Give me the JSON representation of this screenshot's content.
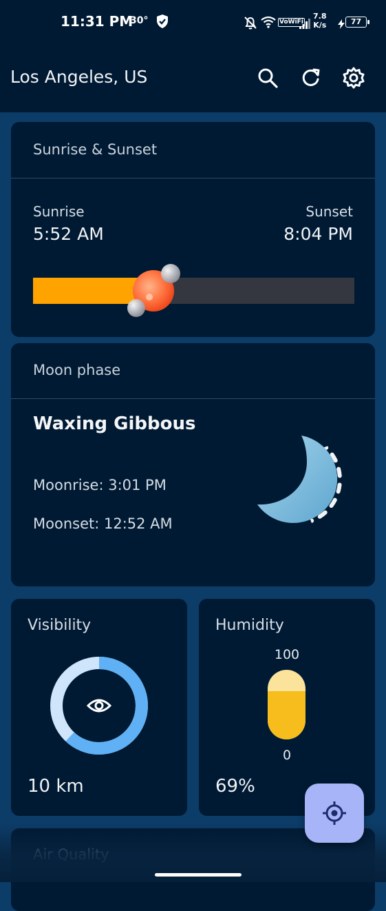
{
  "status_bar": {
    "time": "11:31 PM",
    "temperature": "30°",
    "network_speed_value": "7.8",
    "network_speed_unit": "K/s",
    "wifi_label": "VoWiFi",
    "battery_level": "77"
  },
  "header": {
    "location": "Los Angeles, US",
    "icons": [
      "search-icon",
      "refresh-icon",
      "settings-icon"
    ]
  },
  "sunrise_card": {
    "title": "Sunrise & Sunset",
    "sunrise_label": "Sunrise",
    "sunrise_time": "5:52 AM",
    "sunset_label": "Sunset",
    "sunset_time": "8:04 PM",
    "day_progress": 0.38,
    "colors": {
      "fill": "#ffa300",
      "track": "#343740",
      "sun": "#ff6a3a"
    }
  },
  "moon_card": {
    "title": "Moon phase",
    "phase": "Waxing Gibbous",
    "moonrise": "Moonrise: 3:01 PM",
    "moonset": "Moonset: 12:52 AM",
    "colors": {
      "moon": "#7fbddc"
    }
  },
  "visibility_card": {
    "title": "Visibility",
    "value": "10 km",
    "ring_fraction": 0.62,
    "icon": "eye-icon",
    "colors": {
      "ring": "#5fb0f4",
      "ring_track": "#cfe5fb"
    }
  },
  "humidity_card": {
    "title": "Humidity",
    "scale_max": "100",
    "scale_min": "0",
    "value": "69%",
    "fill_fraction": 0.69,
    "colors": {
      "fill": "#f7bd1c",
      "empty": "#fbe39b"
    }
  },
  "air_quality_card": {
    "title": "Air Quality"
  },
  "fab": {
    "icon": "my-location-icon",
    "colors": {
      "background": "#a7b5f8"
    }
  }
}
